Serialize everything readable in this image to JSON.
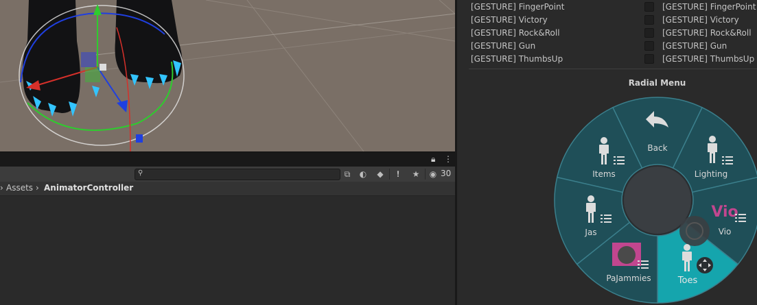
{
  "scene": {
    "colors": {
      "background": "#7a6f66",
      "axis_x": "#d6302a",
      "axis_y": "#2ecc2e",
      "axis_z": "#1f3fe0",
      "claw": "#33c4ff"
    }
  },
  "toolbar": {
    "hidden_count": "30",
    "icons": [
      "search-icon",
      "scene-visibility-icon",
      "label-tag-icon",
      "error-filter-icon",
      "favorite-star-icon",
      "hidden-eye-icon"
    ]
  },
  "breadcrumb": {
    "items": [
      "Assets",
      "AnimatorController"
    ]
  },
  "gestures": {
    "left": [
      "[GESTURE] FingerPoint",
      "[GESTURE] Victory",
      "[GESTURE] Rock&Roll",
      "[GESTURE] Gun",
      "[GESTURE] ThumbsUp"
    ],
    "right": [
      "[GESTURE] FingerPoint",
      "[GESTURE] Victory",
      "[GESTURE] Rock&Roll",
      "[GESTURE] Gun",
      "[GESTURE] ThumbsUp"
    ]
  },
  "radial": {
    "title": "Radial Menu",
    "items": {
      "back": "Back",
      "lighting": "Lighting",
      "vio": "Vio",
      "toes": "Toes",
      "pajammies": "PaJammies",
      "jas": "Jas",
      "items": "Items"
    },
    "logo_text": "Vio",
    "colors": {
      "ring": "#1f4f58",
      "ring_border": "#3b7f8c",
      "selected": "#15a5ad",
      "center": "#3a3e42"
    }
  }
}
